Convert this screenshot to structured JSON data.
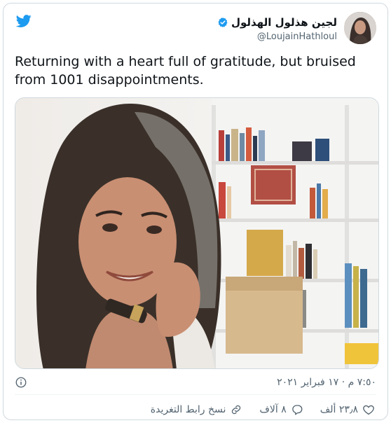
{
  "tweet": {
    "author": {
      "display_name": "لجين هذلول الهذلول",
      "handle": "@LoujainHathloul",
      "verified": true
    },
    "text": "Returning with a heart full of gratitude, but bruised from 1001 disappointments.",
    "timestamp": "٧:٥٠ م · ١٧ فبراير ٢٠٢١",
    "actions": {
      "likes": "٢٣٫٨ ألف",
      "replies": "٨ آلاف",
      "copy_link": "نسخ رابط التغريدة"
    }
  },
  "icons": {
    "brand": "twitter-bird-icon",
    "verified": "verified-badge-icon",
    "info": "info-icon",
    "like": "heart-icon",
    "reply": "reply-icon",
    "copy": "link-icon"
  },
  "colors": {
    "brand_blue": "#1d9bf0",
    "text_primary": "#0f1419",
    "text_secondary": "#536471",
    "border": "#cfd9de"
  }
}
